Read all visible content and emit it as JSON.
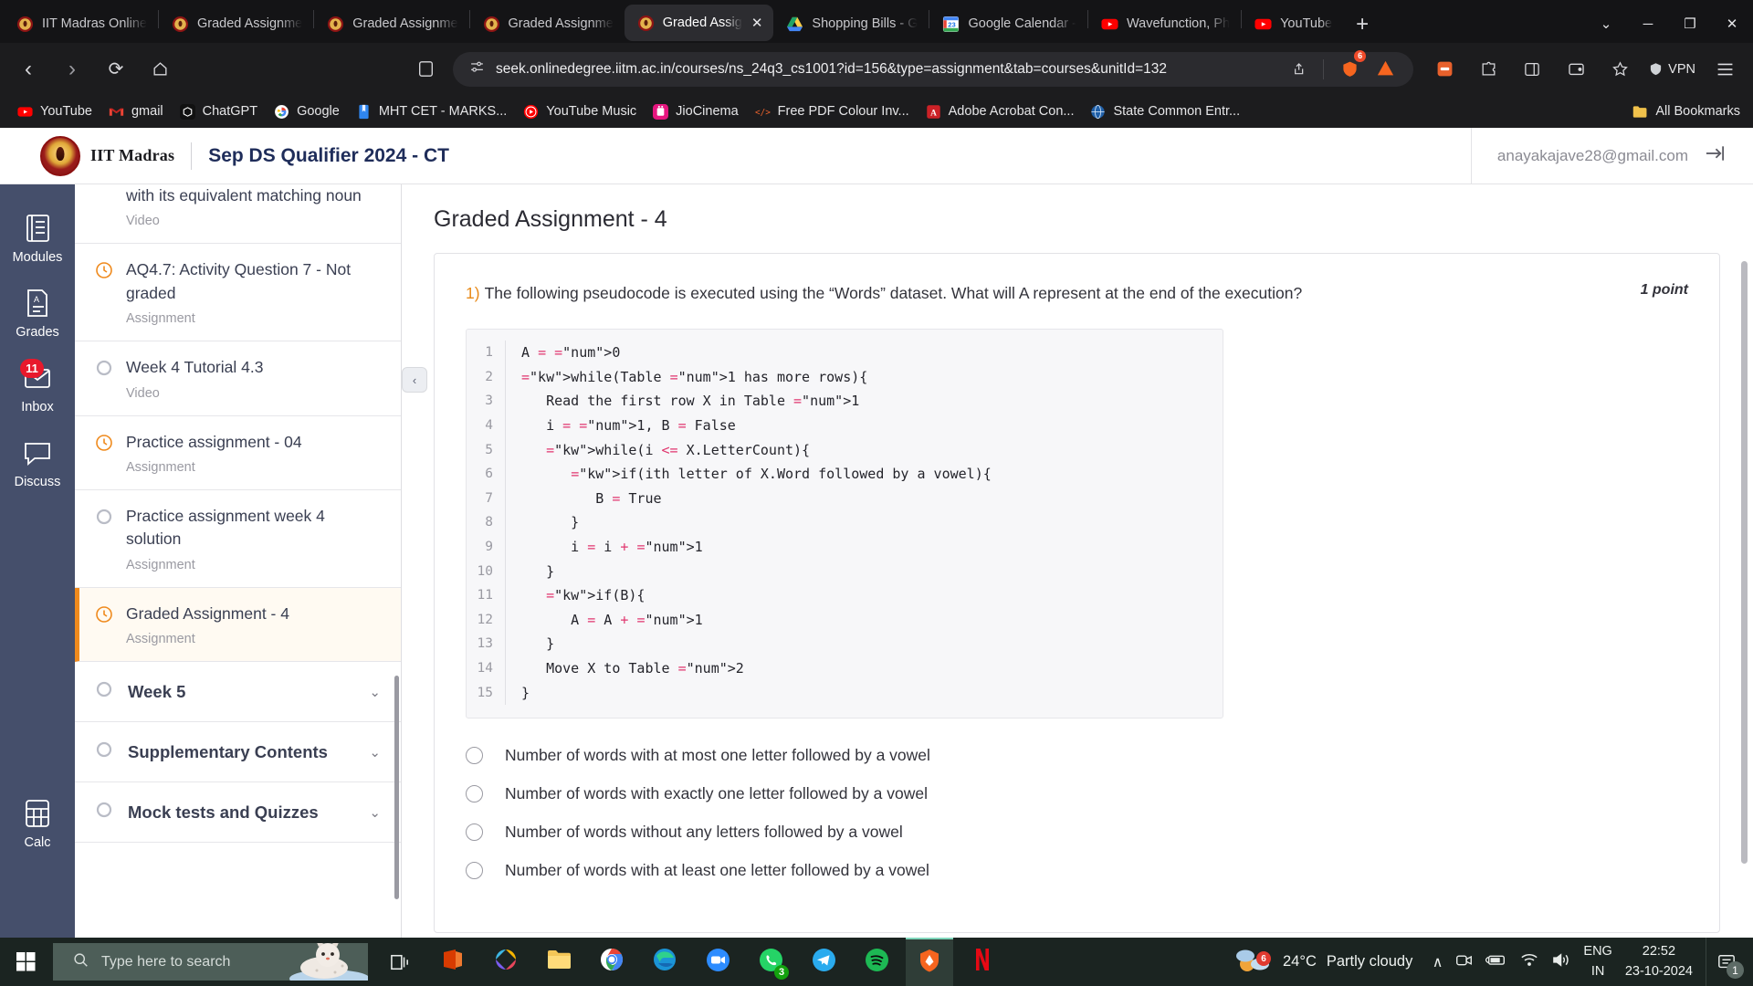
{
  "browser": {
    "tabs": [
      {
        "label": "IIT Madras Online",
        "favicon": "iitm-icon",
        "active": false
      },
      {
        "label": "Graded Assignme",
        "favicon": "iitm-icon",
        "active": false
      },
      {
        "label": "Graded Assignme",
        "favicon": "iitm-icon",
        "active": false
      },
      {
        "label": "Graded Assignme",
        "favicon": "iitm-icon",
        "active": false
      },
      {
        "label": "Graded Assig",
        "favicon": "iitm-icon",
        "active": true
      },
      {
        "label": "Shopping Bills - G",
        "favicon": "google-drive-icon",
        "active": false
      },
      {
        "label": "Google Calendar -",
        "favicon": "google-calendar-icon",
        "active": false
      },
      {
        "label": "Wavefunction, Ph",
        "favicon": "youtube-icon",
        "active": false
      },
      {
        "label": "YouTube",
        "favicon": "youtube-icon",
        "active": false
      }
    ],
    "tab_close_label": "✕",
    "new_tab_label": "+",
    "window_controls": {
      "list": "⌄",
      "minimize": "─",
      "maximize": "❐",
      "close": "✕"
    },
    "nav": {
      "back": "‹",
      "forward": "›",
      "reload": "⟳",
      "home": "⌂",
      "split_view": "split-view-icon"
    },
    "omnibox": {
      "url": "seek.onlinedegree.iitm.ac.in/courses/ns_24q3_cs1001?id=156&type=assignment&tab=courses&unitId=132",
      "site_settings_icon": "tune-icon",
      "share_icon": "share-icon",
      "shield_badge": "6",
      "brave_icon": "brave-lion-icon",
      "accent": "#f6651f"
    },
    "toolbar_right": {
      "extension_orange": "extension-orange-icon",
      "extensions": "puzzle-icon",
      "sidebar": "sidebar-icon",
      "wallet": "wallet-icon",
      "bookmark_star": "star-icon",
      "vpn_label": "VPN",
      "menu": "hamburger-menu-icon"
    },
    "bookmarks": [
      {
        "label": "YouTube",
        "icon": "youtube-icon"
      },
      {
        "label": "gmail",
        "icon": "gmail-icon"
      },
      {
        "label": "ChatGPT",
        "icon": "chatgpt-icon"
      },
      {
        "label": "Google",
        "icon": "google-icon"
      },
      {
        "label": "MHT CET - MARKS...",
        "icon": "document-blue-icon"
      },
      {
        "label": "YouTube Music",
        "icon": "youtube-music-icon"
      },
      {
        "label": "JioCinema",
        "icon": "jiocinema-icon"
      },
      {
        "label": "Free PDF Colour Inv...",
        "icon": "code-tag-icon"
      },
      {
        "label": "Adobe Acrobat Con...",
        "icon": "adobe-acrobat-icon"
      },
      {
        "label": "State Common Entr...",
        "icon": "globe-blue-icon"
      }
    ],
    "all_bookmarks_label": "All Bookmarks",
    "all_bookmarks_icon": "folder-icon"
  },
  "app": {
    "brand": "IIT Madras",
    "course_title": "Sep DS Qualifier 2024 - CT",
    "user_email": "anayakajave28@gmail.com",
    "logout_icon": "logout-icon",
    "rail": [
      {
        "label": "Modules",
        "icon": "modules-icon",
        "badge": null,
        "active": true
      },
      {
        "label": "Grades",
        "icon": "grades-icon",
        "badge": null,
        "active": false
      },
      {
        "label": "Inbox",
        "icon": "inbox-icon",
        "badge": "11",
        "active": false
      },
      {
        "label": "Discuss",
        "icon": "discuss-icon",
        "badge": null,
        "active": false
      }
    ],
    "rail_bottom": {
      "label": "Calc",
      "icon": "calculator-icon"
    },
    "collapse_icon": "‹"
  },
  "modules": {
    "items": [
      {
        "title": "with its equivalent matching noun",
        "sub": "Video",
        "status": "circle",
        "partial": true,
        "active": false
      },
      {
        "title": "AQ4.7: Activity Question 7 - Not graded",
        "sub": "Assignment",
        "status": "clock",
        "partial": false,
        "active": false
      },
      {
        "title": "Week 4 Tutorial 4.3",
        "sub": "Video",
        "status": "circle",
        "partial": false,
        "active": false
      },
      {
        "title": "Practice assignment - 04",
        "sub": "Assignment",
        "status": "clock",
        "partial": false,
        "active": false
      },
      {
        "title": "Practice assignment week 4 solution",
        "sub": "Assignment",
        "status": "circle",
        "partial": false,
        "active": false
      },
      {
        "title": "Graded Assignment - 4",
        "sub": "Assignment",
        "status": "clock",
        "partial": false,
        "active": true
      }
    ],
    "weeks": [
      {
        "label": "Week 5",
        "chevron": "⌄"
      },
      {
        "label": "Supplementary Contents",
        "chevron": "⌄"
      },
      {
        "label": "Mock tests and Quizzes",
        "chevron": "⌄"
      }
    ]
  },
  "assignment": {
    "page_title": "Graded Assignment - 4",
    "question": {
      "number": "1)",
      "text": "The following pseudocode is executed using the “Words” dataset. What will A represent at the end of the execution?",
      "points": "1 point"
    },
    "code": {
      "line_numbers": [
        "1",
        "2",
        "3",
        "4",
        "5",
        "6",
        "7",
        "8",
        "9",
        "10",
        "11",
        "12",
        "13",
        "14",
        "15"
      ],
      "lines": [
        "A = 0",
        "while(Table 1 has more rows){",
        "   Read the first row X in Table 1",
        "   i = 1, B = False",
        "   while(i <= X.LetterCount){",
        "      if(ith letter of X.Word followed by a vowel){",
        "         B = True",
        "      }",
        "      i = i + 1",
        "   }",
        "   if(B){",
        "      A = A + 1",
        "   }",
        "   Move X to Table 2",
        "}"
      ]
    },
    "options": [
      {
        "label": "Number of words with at most one letter followed by a vowel",
        "selected": false
      },
      {
        "label": "Number of words with exactly one letter followed by a vowel",
        "selected": false
      },
      {
        "label": "Number of words without any letters followed by a vowel",
        "selected": false
      },
      {
        "label": "Number of words with at least one letter followed by a vowel",
        "selected": false
      }
    ]
  },
  "taskbar": {
    "start_icon": "windows-start-icon",
    "search_placeholder": "Type here to search",
    "search_icon": "search-icon",
    "task_view_icon": "task-view-icon",
    "apps": [
      {
        "name": "microsoft-office-icon",
        "badge": null,
        "active": false
      },
      {
        "name": "photos-icon",
        "badge": null,
        "active": false
      },
      {
        "name": "file-explorer-icon",
        "badge": null,
        "active": false
      },
      {
        "name": "chrome-icon",
        "badge": null,
        "active": false
      },
      {
        "name": "microsoft-edge-icon",
        "badge": null,
        "active": false
      },
      {
        "name": "zoom-icon",
        "badge": null,
        "active": false
      },
      {
        "name": "whatsapp-icon",
        "badge": "3",
        "active": false
      },
      {
        "name": "telegram-icon",
        "badge": null,
        "active": false
      },
      {
        "name": "spotify-icon",
        "badge": null,
        "active": false
      },
      {
        "name": "brave-icon",
        "badge": null,
        "active": true
      },
      {
        "name": "netflix-icon",
        "badge": null,
        "active": false
      }
    ],
    "weather": {
      "temp": "24°C",
      "condition": "Partly cloudy",
      "badge": "6",
      "icon": "partly-cloudy-icon"
    },
    "tray": {
      "show_hidden": "∧",
      "camera_icon": "camera-icon",
      "battery_icon": "battery-charging-icon",
      "wifi_icon": "wifi-icon",
      "volume_icon": "volume-icon"
    },
    "language": {
      "line1": "ENG",
      "line2": "IN"
    },
    "clock": {
      "time": "22:52",
      "date": "23-10-2024"
    },
    "notification_count": "1",
    "notification_icon": "notification-icon"
  }
}
